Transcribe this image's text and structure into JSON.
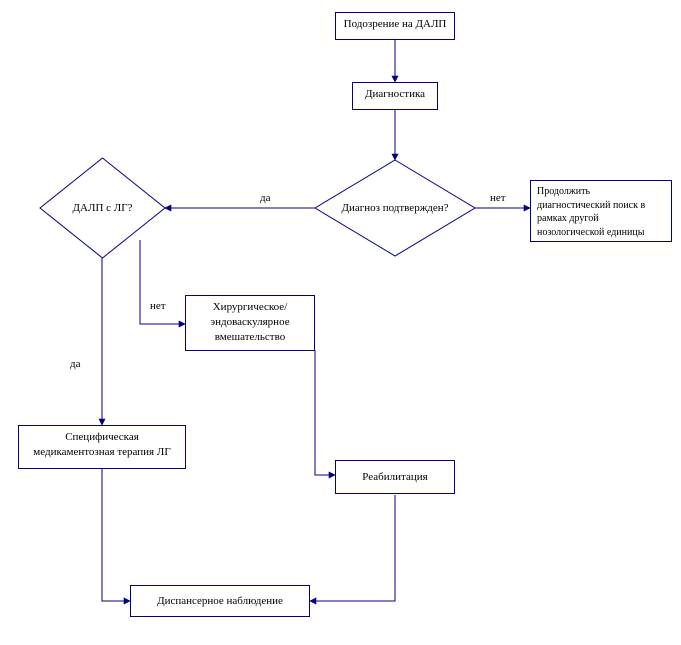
{
  "nodes": {
    "start": "Подозрение на ДАЛП",
    "diag": "Диагностика",
    "confirm": "Диагноз подтвержден?",
    "other": "Продолжить диагностический поиск в рамках другой нозологической единицы",
    "dalp_lg": "ДАЛП с ЛГ?",
    "surgery": "Хирургическое/ эндоваскулярное вмешательство",
    "therapy": "Специфическая медикаментозная терапия ЛГ",
    "rehab": "Реабилитация",
    "followup": "Диспансерное наблюдение"
  },
  "labels": {
    "yes": "да",
    "no": "нет"
  },
  "chart_data": {
    "type": "flowchart",
    "nodes": [
      {
        "id": "start",
        "shape": "rect",
        "text": "Подозрение на ДАЛП"
      },
      {
        "id": "diag",
        "shape": "rect",
        "text": "Диагностика"
      },
      {
        "id": "confirm",
        "shape": "diamond",
        "text": "Диагноз подтвержден?"
      },
      {
        "id": "other",
        "shape": "rect",
        "text": "Продолжить диагностический поиск в рамках другой нозологической единицы"
      },
      {
        "id": "dalp_lg",
        "shape": "diamond",
        "text": "ДАЛП с ЛГ?"
      },
      {
        "id": "surgery",
        "shape": "rect",
        "text": "Хирургическое/ эндоваскулярное вмешательство"
      },
      {
        "id": "therapy",
        "shape": "rect",
        "text": "Специфическая медикаментозная терапия ЛГ"
      },
      {
        "id": "rehab",
        "shape": "rect",
        "text": "Реабилитация"
      },
      {
        "id": "followup",
        "shape": "rect",
        "text": "Диспансерное наблюдение"
      }
    ],
    "edges": [
      {
        "from": "start",
        "to": "diag",
        "label": null
      },
      {
        "from": "diag",
        "to": "confirm",
        "label": null
      },
      {
        "from": "confirm",
        "to": "other",
        "label": "нет"
      },
      {
        "from": "confirm",
        "to": "dalp_lg",
        "label": "да"
      },
      {
        "from": "dalp_lg",
        "to": "therapy",
        "label": "да"
      },
      {
        "from": "dalp_lg",
        "to": "surgery",
        "label": "нет"
      },
      {
        "from": "surgery",
        "to": "rehab",
        "label": null
      },
      {
        "from": "therapy",
        "to": "followup",
        "label": null
      },
      {
        "from": "rehab",
        "to": "followup",
        "label": null
      }
    ]
  }
}
